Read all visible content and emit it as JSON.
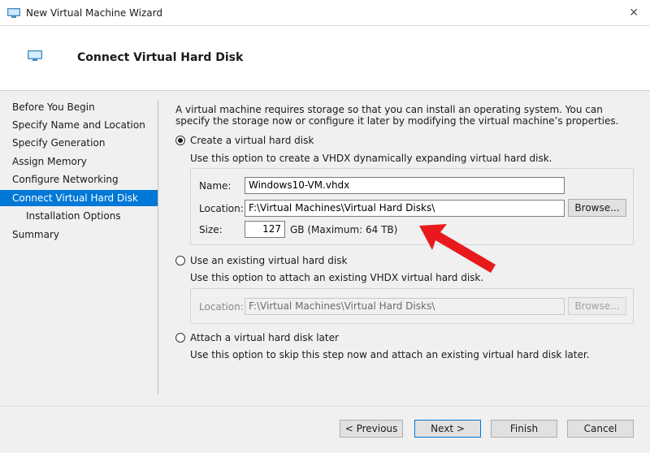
{
  "window": {
    "title": "New Virtual Machine Wizard"
  },
  "header": {
    "title": "Connect Virtual Hard Disk"
  },
  "nav": {
    "items": [
      {
        "label": "Before You Begin"
      },
      {
        "label": "Specify Name and Location"
      },
      {
        "label": "Specify Generation"
      },
      {
        "label": "Assign Memory"
      },
      {
        "label": "Configure Networking"
      },
      {
        "label": "Connect Virtual Hard Disk"
      },
      {
        "label": "Installation Options"
      },
      {
        "label": "Summary"
      }
    ],
    "active_index": 5
  },
  "content": {
    "intro": "A virtual machine requires storage so that you can install an operating system. You can specify the storage now or configure it later by modifying the virtual machine’s properties.",
    "create": {
      "label": "Create a virtual hard disk",
      "checked": true,
      "description": "Use this option to create a VHDX dynamically expanding virtual hard disk.",
      "name_label": "Name:",
      "name_value": "Windows10-VM.vhdx",
      "location_label": "Location:",
      "location_value": "F:\\Virtual Machines\\Virtual Hard Disks\\",
      "browse_label": "Browse...",
      "size_label": "Size:",
      "size_value": "127",
      "size_unit": "GB (Maximum: 64 TB)"
    },
    "existing": {
      "label": "Use an existing virtual hard disk",
      "checked": false,
      "description": "Use this option to attach an existing VHDX virtual hard disk.",
      "location_label": "Location:",
      "location_value": "F:\\Virtual Machines\\Virtual Hard Disks\\",
      "browse_label": "Browse..."
    },
    "later": {
      "label": "Attach a virtual hard disk later",
      "checked": false,
      "description": "Use this option to skip this step now and attach an existing virtual hard disk later."
    }
  },
  "buttons": {
    "previous": "< Previous",
    "next": "Next >",
    "finish": "Finish",
    "cancel": "Cancel"
  },
  "colors": {
    "accent": "#0078d7",
    "annotation_arrow": "#e8191c"
  }
}
